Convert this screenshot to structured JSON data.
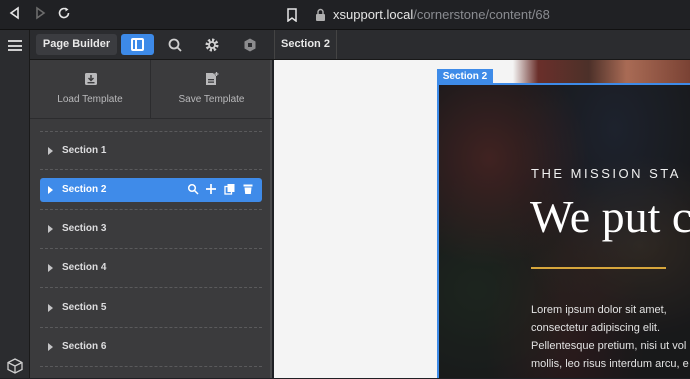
{
  "browser": {
    "url_host": "xsupport.local",
    "url_path": "/cornerstone/content/68",
    "icons": [
      "back-icon",
      "forward-icon",
      "reload-icon",
      "bookmark-icon",
      "lock-icon"
    ]
  },
  "toolbar": {
    "page_builder_label": "Page Builder",
    "breadcrumb": "Section 2",
    "icons": [
      "layout-icon",
      "search-icon",
      "gear-icon",
      "hexagon-icon"
    ]
  },
  "rail": {
    "icons": [
      "menu-icon",
      "cube-icon"
    ]
  },
  "templates": {
    "load_label": "Load Template",
    "save_label": "Save Template"
  },
  "sections": [
    {
      "label": "Section 1",
      "active": false
    },
    {
      "label": "Section 2",
      "active": true
    },
    {
      "label": "Section 3",
      "active": false
    },
    {
      "label": "Section 4",
      "active": false
    },
    {
      "label": "Section 5",
      "active": false
    },
    {
      "label": "Section 6",
      "active": false
    }
  ],
  "preview": {
    "section_tab": "Section 2",
    "kicker": "THE MISSION STA",
    "headline": "We put c",
    "body": "Lorem ipsum dolor sit amet,\nconsectetur adipiscing elit.\nPellentesque pretium, nisi ut vol\nmollis, leo risus interdum arcu, e"
  },
  "colors": {
    "accent": "#3e8be8",
    "rule": "#d7a63c"
  }
}
